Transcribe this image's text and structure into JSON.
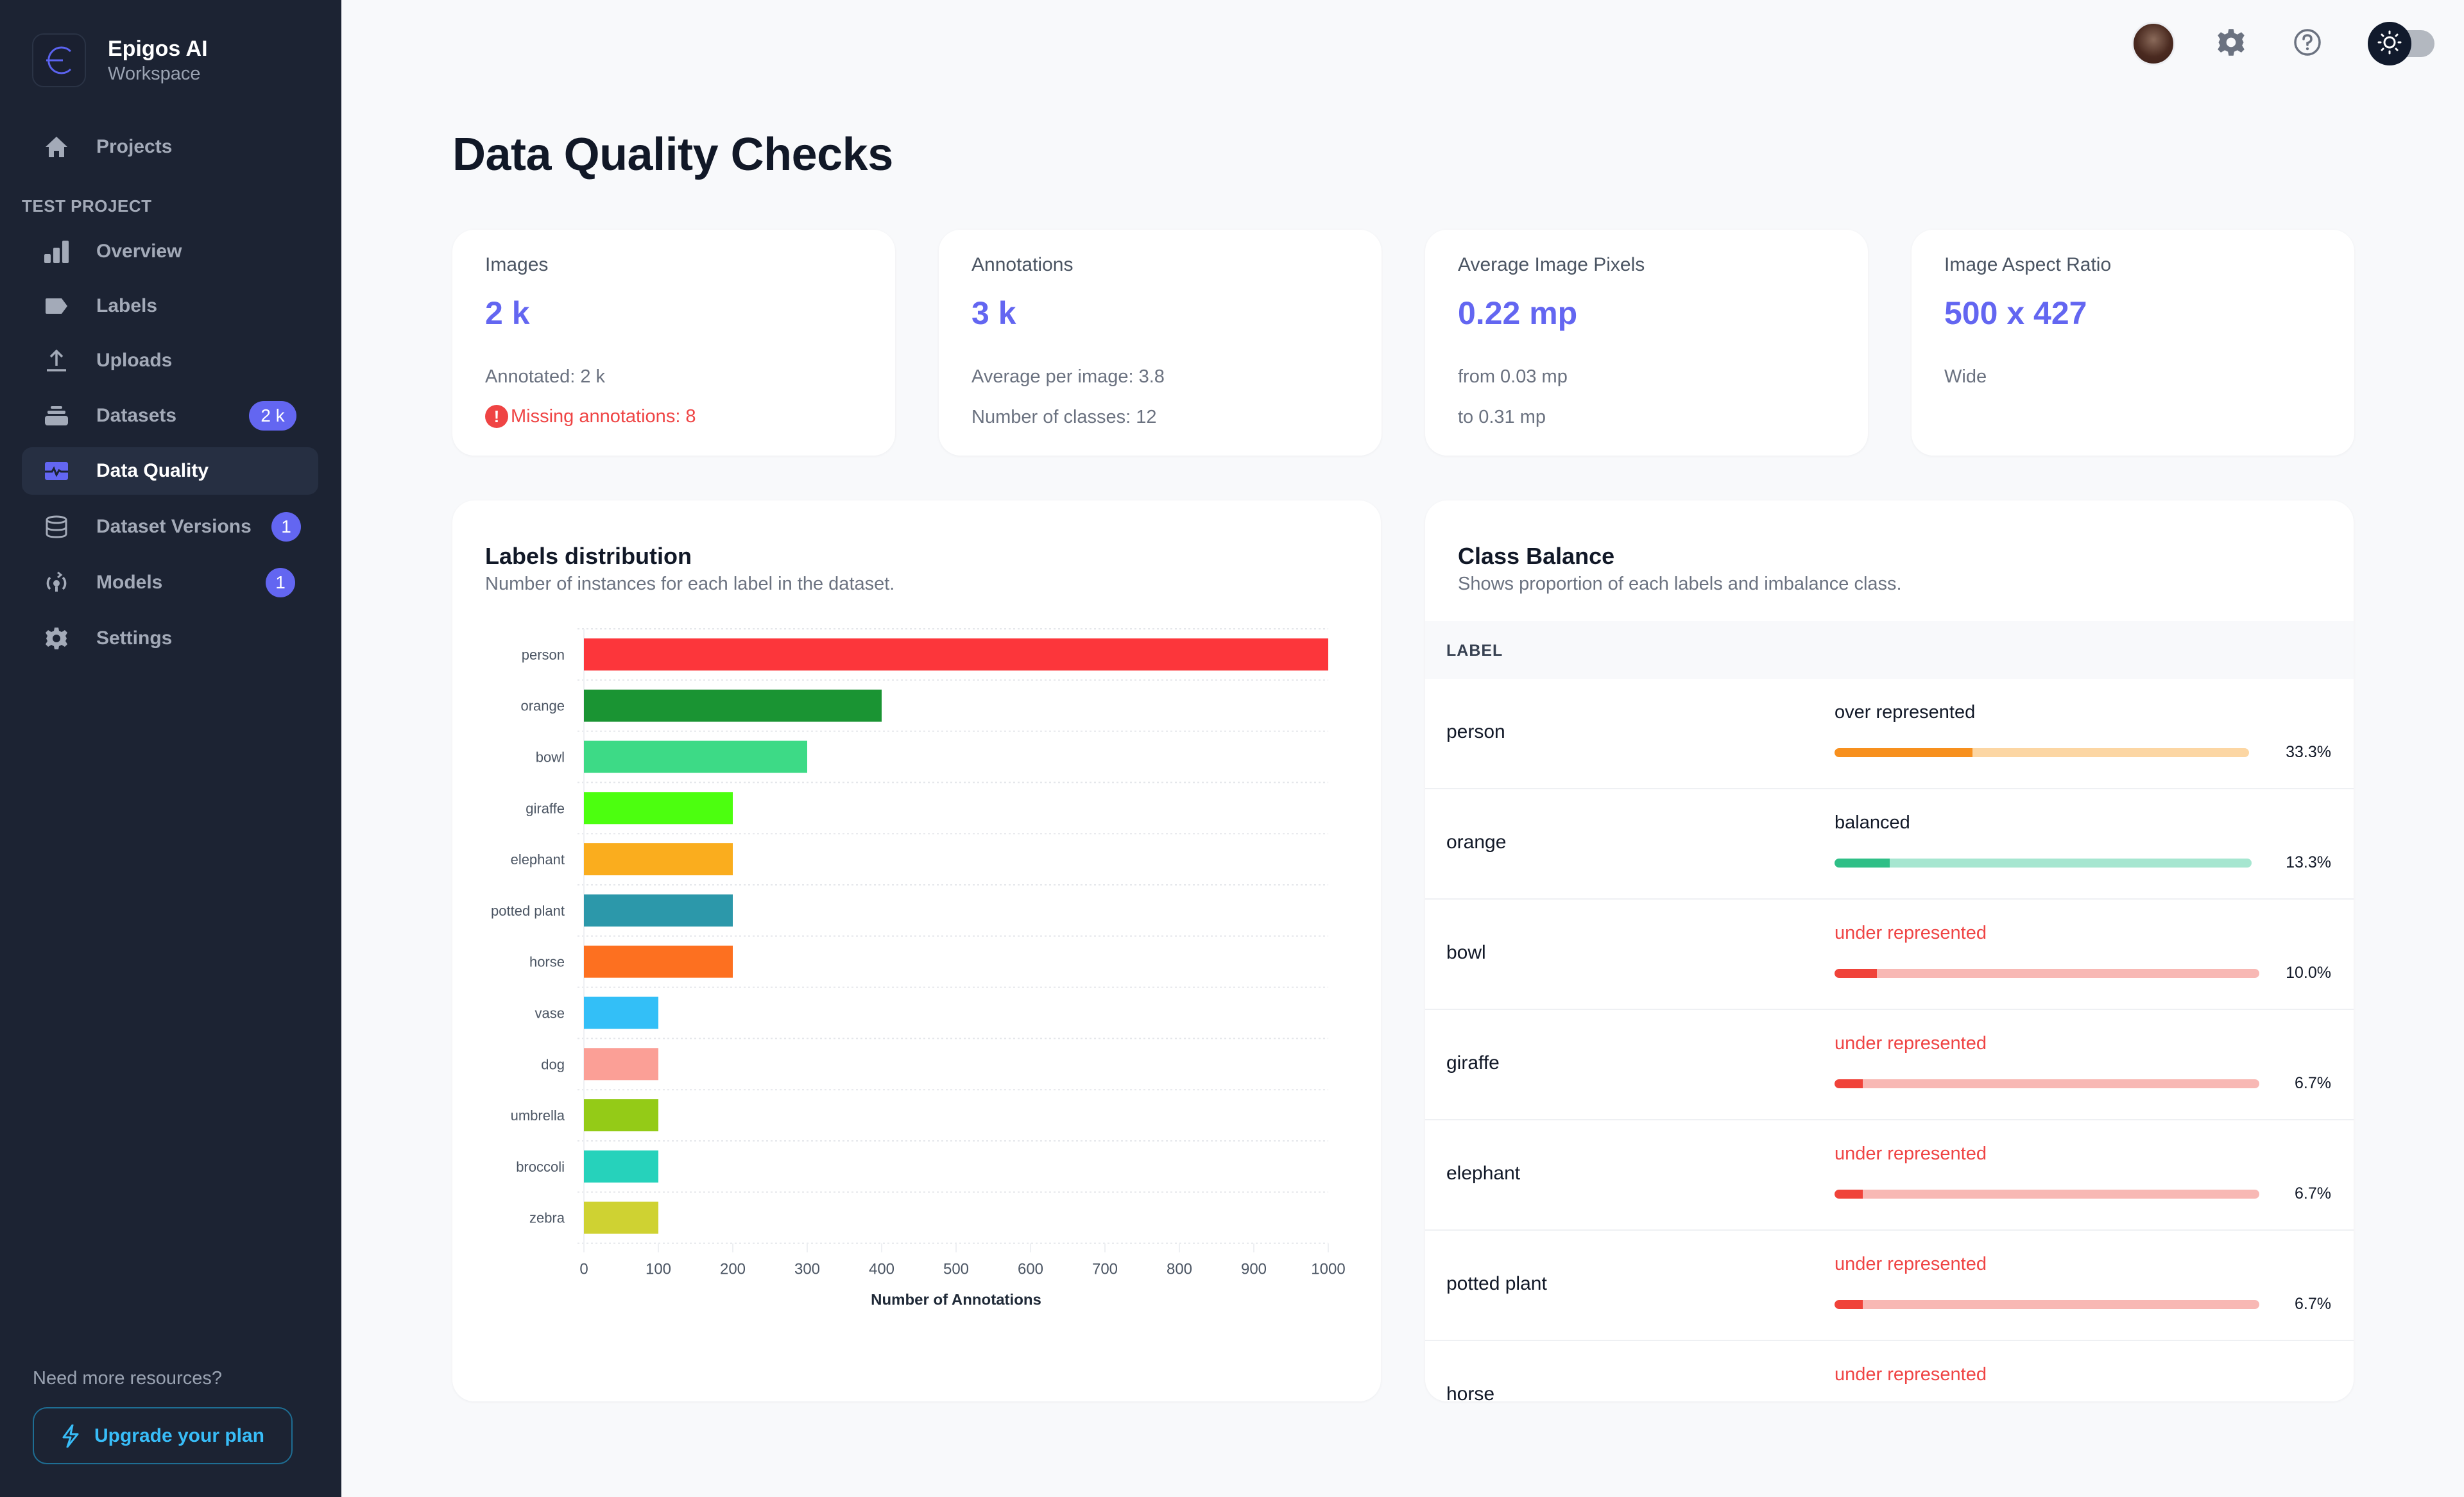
{
  "brand": {
    "name": "Epigos AI",
    "subtitle": "Workspace"
  },
  "sidebar": {
    "top_item": {
      "label": "Projects",
      "icon": "home-icon"
    },
    "section_label": "TEST PROJECT",
    "items": [
      {
        "label": "Overview",
        "icon": "bar-chart-icon",
        "badge": null,
        "active": false
      },
      {
        "label": "Labels",
        "icon": "tag-icon",
        "badge": null,
        "active": false
      },
      {
        "label": "Uploads",
        "icon": "upload-icon",
        "badge": null,
        "active": false
      },
      {
        "label": "Datasets",
        "icon": "stack-icon",
        "badge": "2 k",
        "active": false
      },
      {
        "label": "Data Quality",
        "icon": "pulse-icon",
        "badge": null,
        "active": true
      },
      {
        "label": "Dataset Versions",
        "icon": "database-icon",
        "badge": "1",
        "active": false
      },
      {
        "label": "Models",
        "icon": "model-icon",
        "badge": "1",
        "active": false
      },
      {
        "label": "Settings",
        "icon": "gear-icon",
        "badge": null,
        "active": false
      }
    ],
    "resources_text": "Need more resources?",
    "upgrade_label": "Upgrade your plan"
  },
  "topbar": {
    "avatar": "user-avatar",
    "settings_icon": "gear-icon",
    "help_icon": "help-circle-icon",
    "theme_toggle": "sun-icon"
  },
  "page": {
    "title": "Data Quality Checks"
  },
  "stats": [
    {
      "title": "Images",
      "value": "2 k",
      "lines": [
        "Annotated: 2 k"
      ],
      "warning": "Missing annotations: 8"
    },
    {
      "title": "Annotations",
      "value": "3 k",
      "lines": [
        "Average per image: 3.8",
        "Number of classes: 12"
      ]
    },
    {
      "title": "Average Image Pixels",
      "value": "0.22 mp",
      "lines": [
        "from 0.03 mp",
        "to 0.31 mp"
      ]
    },
    {
      "title": "Image Aspect Ratio",
      "value": "500 x 427",
      "lines": [
        "Wide"
      ]
    }
  ],
  "labels_panel": {
    "title": "Labels distribution",
    "subtitle": "Number of instances for each label in the dataset."
  },
  "chart_data": {
    "type": "bar",
    "orientation": "horizontal",
    "title": "Labels distribution",
    "xlabel": "Number of Annotations",
    "ylabel": "",
    "categories": [
      "person",
      "orange",
      "bowl",
      "giraffe",
      "elephant",
      "potted plant",
      "horse",
      "vase",
      "dog",
      "umbrella",
      "broccoli",
      "zebra"
    ],
    "values": [
      1000,
      400,
      300,
      200,
      200,
      200,
      200,
      100,
      100,
      100,
      100,
      100
    ],
    "colors": [
      "#fc363b",
      "#1a9433",
      "#3dda86",
      "#4cff0f",
      "#faad1e",
      "#2c98aa",
      "#fd7020",
      "#33bff7",
      "#fb9f96",
      "#94cb17",
      "#26d2bb",
      "#cfd232"
    ],
    "xlim": [
      0,
      1000
    ],
    "xticks": [
      "0",
      "100",
      "200",
      "300",
      "400",
      "500",
      "600",
      "700",
      "800",
      "900",
      "1000"
    ],
    "grid": true,
    "legend": "none"
  },
  "class_balance": {
    "title": "Class Balance",
    "subtitle": "Shows proportion of each labels and imbalance class.",
    "column_header": "LABEL",
    "rows": [
      {
        "label": "person",
        "status": "over represented",
        "kind": "over",
        "percent": 33.3,
        "percent_text": "33.3%"
      },
      {
        "label": "orange",
        "status": "balanced",
        "kind": "balanced",
        "percent": 13.3,
        "percent_text": "13.3%"
      },
      {
        "label": "bowl",
        "status": "under represented",
        "kind": "under",
        "percent": 10.0,
        "percent_text": "10.0%"
      },
      {
        "label": "giraffe",
        "status": "under represented",
        "kind": "under",
        "percent": 6.7,
        "percent_text": "6.7%"
      },
      {
        "label": "elephant",
        "status": "under represented",
        "kind": "under",
        "percent": 6.7,
        "percent_text": "6.7%"
      },
      {
        "label": "potted plant",
        "status": "under represented",
        "kind": "under",
        "percent": 6.7,
        "percent_text": "6.7%"
      },
      {
        "label": "horse",
        "status": "under represented",
        "kind": "under",
        "percent": null,
        "percent_text": ""
      }
    ],
    "colors": {
      "over": {
        "fill": "#f7901e",
        "track": "#fcd6a3"
      },
      "balanced": {
        "fill": "#2fbf87",
        "track": "#a6e6d0"
      },
      "under": {
        "fill": "#f0433a",
        "track": "#f8b8b4"
      }
    }
  },
  "colors": {
    "accent": "#6366f1",
    "sidebar_bg": "#1c2333",
    "page_bg": "#f8f9fb",
    "danger": "#ef4444",
    "upgrade": "#38bdf8"
  }
}
